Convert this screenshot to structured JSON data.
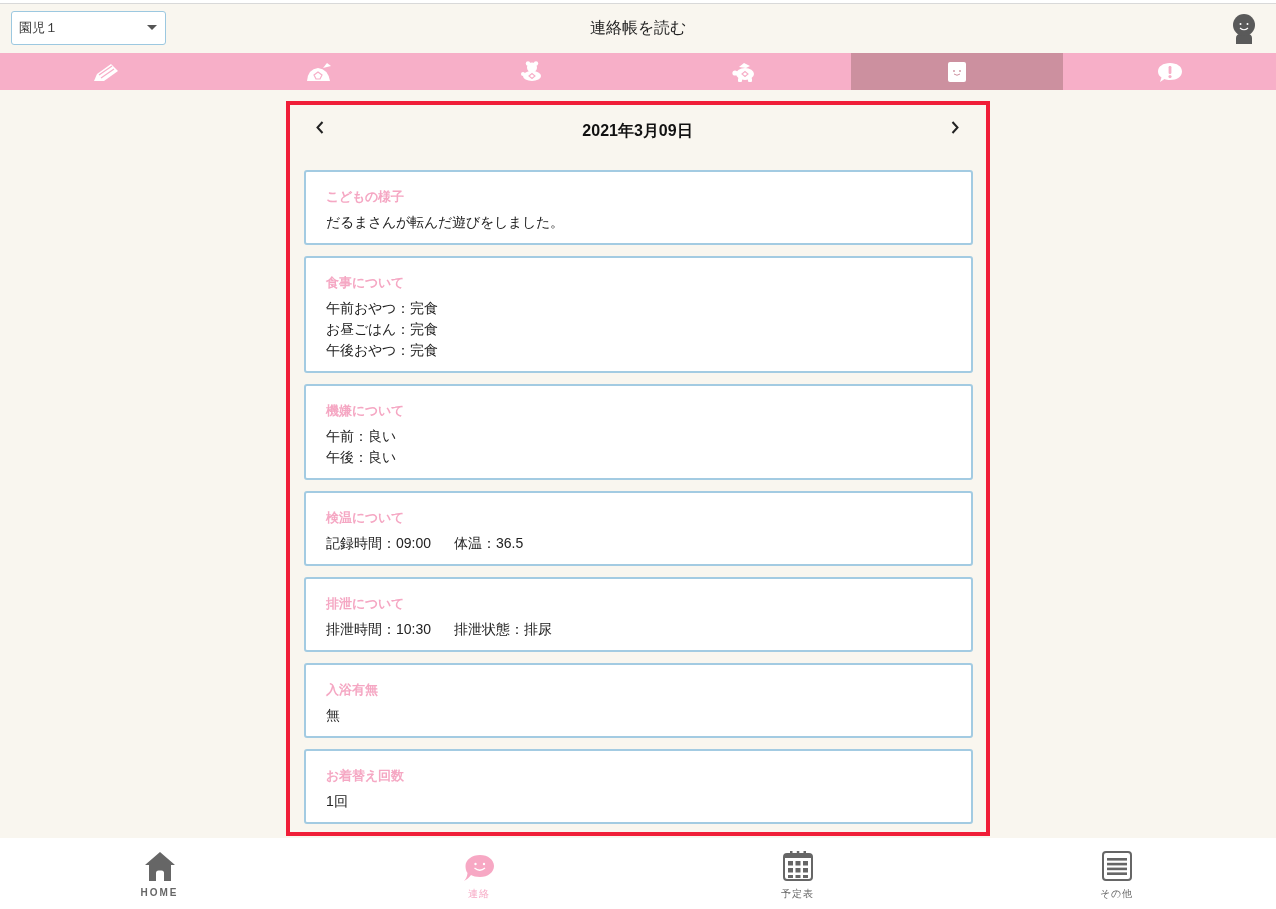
{
  "header": {
    "child_select": {
      "value": "園児１"
    },
    "title": "連絡帳を読む"
  },
  "category_tabs": [
    {
      "kind": "pencil",
      "selected": false
    },
    {
      "kind": "shell",
      "selected": false
    },
    {
      "kind": "bear",
      "selected": false
    },
    {
      "kind": "turtle",
      "selected": false
    },
    {
      "kind": "notebook",
      "selected": true
    },
    {
      "kind": "alert",
      "selected": false
    }
  ],
  "date_nav": {
    "date": "2021年3月09日"
  },
  "cards": [
    {
      "title": "こどもの様子",
      "rows": [
        {
          "fields": [
            "だるまさんが転んだ遊びをしました。"
          ]
        }
      ]
    },
    {
      "title": "食事について",
      "rows": [
        {
          "fields": [
            "午前おやつ：完食"
          ]
        },
        {
          "fields": [
            "お昼ごはん：完食"
          ]
        },
        {
          "fields": [
            "午後おやつ：完食"
          ]
        }
      ]
    },
    {
      "title": "機嫌について",
      "rows": [
        {
          "fields": [
            "午前：良い"
          ]
        },
        {
          "fields": [
            "午後：良い"
          ]
        }
      ]
    },
    {
      "title": "検温について",
      "rows": [
        {
          "fields": [
            "記録時間：09:00",
            "体温：36.5"
          ]
        }
      ]
    },
    {
      "title": "排泄について",
      "rows": [
        {
          "fields": [
            "排泄時間：10:30",
            "排泄状態：排尿"
          ]
        }
      ]
    },
    {
      "title": "入浴有無",
      "rows": [
        {
          "fields": [
            "無"
          ]
        }
      ]
    },
    {
      "title": "お着替え回数",
      "rows": [
        {
          "fields": [
            "1回"
          ]
        }
      ]
    }
  ],
  "bottom_nav": [
    {
      "kind": "home",
      "label": "HOME",
      "selected": false
    },
    {
      "kind": "message",
      "label": "連絡",
      "selected": true
    },
    {
      "kind": "calendar",
      "label": "予定表",
      "selected": false
    },
    {
      "kind": "menu",
      "label": "その他",
      "selected": false
    }
  ]
}
